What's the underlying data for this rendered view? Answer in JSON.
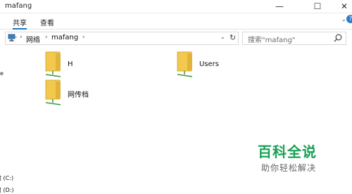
{
  "window": {
    "title": "mafang",
    "controls": {
      "minimize": "—",
      "maximize": "☐",
      "close": "✕"
    }
  },
  "ribbon": {
    "tabs": [
      {
        "label": "共享",
        "selected": true
      },
      {
        "label": "查看",
        "selected": false
      }
    ],
    "expand_icon": "chevron-down-icon",
    "help_label": "?"
  },
  "address_bar": {
    "icon": "network-computer-icon",
    "crumbs": [
      "网络",
      "mafang"
    ]
  },
  "search": {
    "placeholder": "搜索\"mafang\""
  },
  "sidebar": {
    "items": [
      "e",
      "盘 (C:)",
      "盘 (D:)"
    ]
  },
  "content": {
    "items": [
      {
        "name": "H",
        "icon": "network-share-folder-icon"
      },
      {
        "name": "Users",
        "icon": "network-share-folder-icon"
      },
      {
        "name": "网传档",
        "icon": "network-share-folder-icon"
      }
    ]
  },
  "watermark": {
    "title": "百科全说",
    "subtitle": "助你轻松解决"
  }
}
